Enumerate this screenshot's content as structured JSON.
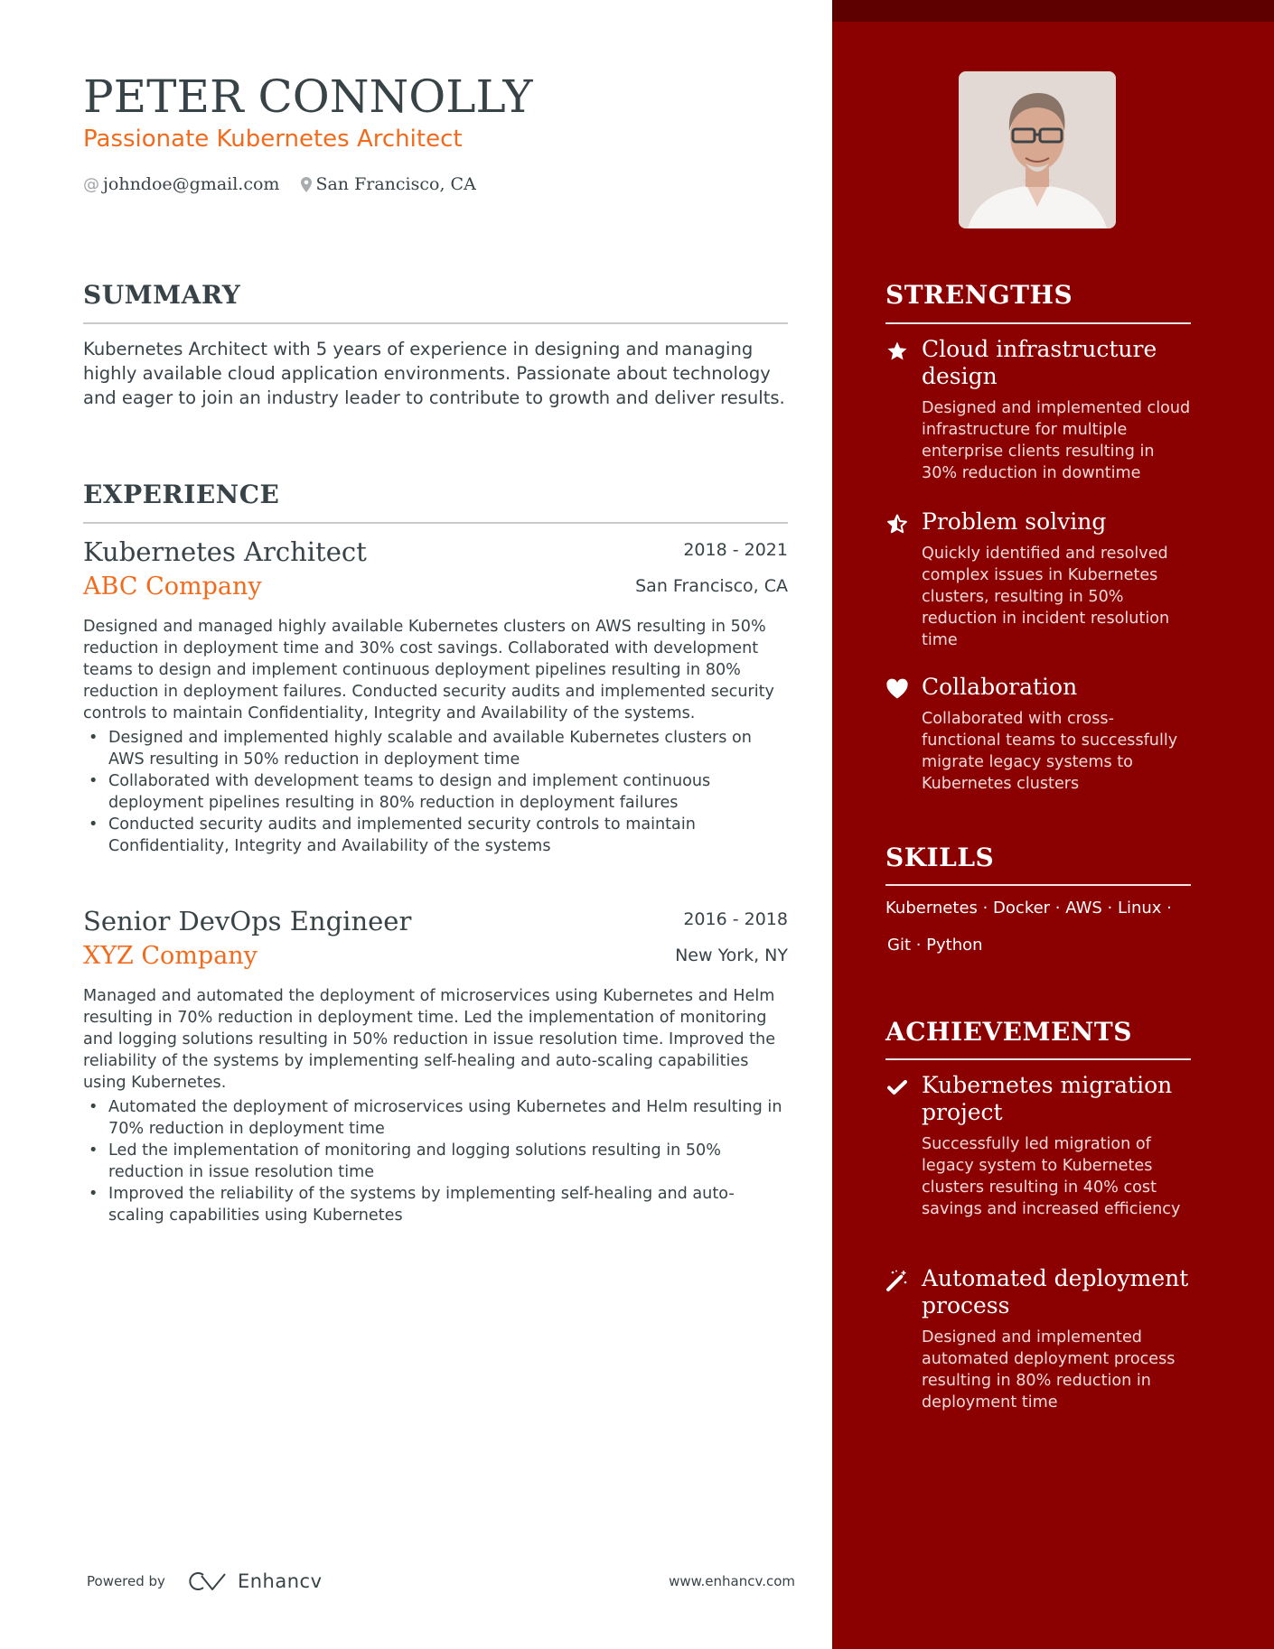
{
  "header": {
    "name": "PETER CONNOLLY",
    "headline": "Passionate Kubernetes Architect",
    "email": "johndoe@gmail.com",
    "location": "San Francisco, CA",
    "email_icon": "at-icon",
    "location_icon": "map-pin-icon"
  },
  "summary": {
    "title": "SUMMARY",
    "text": "Kubernetes Architect with 5 years of experience in designing and managing highly available cloud application environments. Passionate about technology and eager to join an industry leader to contribute to growth and deliver results."
  },
  "experience": {
    "title": "EXPERIENCE",
    "jobs": [
      {
        "title": "Kubernetes Architect",
        "dates": "2018 - 2021",
        "company": "ABC Company",
        "location": "San Francisco, CA",
        "description": "Designed and managed highly available Kubernetes clusters on AWS resulting in 50% reduction in deployment time and 30% cost savings. Collaborated with development teams to design and implement continuous deployment pipelines resulting in 80% reduction in deployment failures. Conducted security audits and implemented security controls to maintain Confidentiality, Integrity and Availability of the systems.",
        "bullets": [
          "Designed and implemented highly scalable and available Kubernetes clusters on AWS resulting in 50% reduction in deployment time",
          "Collaborated with development teams to design and implement continuous deployment pipelines resulting in 80% reduction in deployment failures",
          "Conducted security audits and implemented security controls to maintain Confidentiality, Integrity and Availability of the systems"
        ]
      },
      {
        "title": "Senior DevOps Engineer",
        "dates": "2016 - 2018",
        "company": "XYZ Company",
        "location": "New York, NY",
        "description": "Managed and automated the deployment of microservices using Kubernetes and Helm resulting in 70% reduction in deployment time. Led the implementation of monitoring and logging solutions resulting in 50% reduction in issue resolution time. Improved the reliability of the systems by implementing self-healing and auto-scaling capabilities using Kubernetes.",
        "bullets": [
          "Automated the deployment of microservices using Kubernetes and Helm resulting in 70% reduction in deployment time",
          "Led the implementation of monitoring and logging solutions resulting in 50% reduction in issue resolution time",
          "Improved the reliability of the systems by implementing self-healing and auto-scaling capabilities using Kubernetes"
        ]
      }
    ]
  },
  "strengths": {
    "title": "STRENGTHS",
    "items": [
      {
        "icon": "star-icon",
        "title": "Cloud infrastructure design",
        "description": "Designed and implemented cloud infrastructure for multiple enterprise clients resulting in 30% reduction in downtime"
      },
      {
        "icon": "half-star-icon",
        "title": "Problem solving",
        "description": "Quickly identified and resolved complex issues in Kubernetes clusters, resulting in 50% reduction in incident resolution time"
      },
      {
        "icon": "heart-icon",
        "title": "Collaboration",
        "description": "Collaborated with cross-functional teams to successfully migrate legacy systems to Kubernetes clusters"
      }
    ]
  },
  "skills": {
    "title": "SKILLS",
    "line1": "Kubernetes · Docker · AWS · Linux ·",
    "line2": "Git · Python",
    "items": [
      "Kubernetes",
      "Docker",
      "AWS",
      "Linux",
      "Git",
      "Python"
    ]
  },
  "achievements": {
    "title": "ACHIEVEMENTS",
    "items": [
      {
        "icon": "checkmark-icon",
        "title": "Kubernetes migration project",
        "description": "Successfully led migration of legacy system to Kubernetes clusters resulting in 40% cost savings and increased efficiency"
      },
      {
        "icon": "magic-wand-icon",
        "title": "Automated deployment process",
        "description": "Designed and implemented automated deployment process resulting in 80% reduction in deployment time"
      }
    ]
  },
  "footer": {
    "powered_by": "Powered by",
    "brand": "Enhancv",
    "url": "www.enhancv.com"
  },
  "colors": {
    "accent": "#F26B1D",
    "sidebar": "#8B0000",
    "sidebar_band": "#5F0000",
    "text": "#384347"
  }
}
